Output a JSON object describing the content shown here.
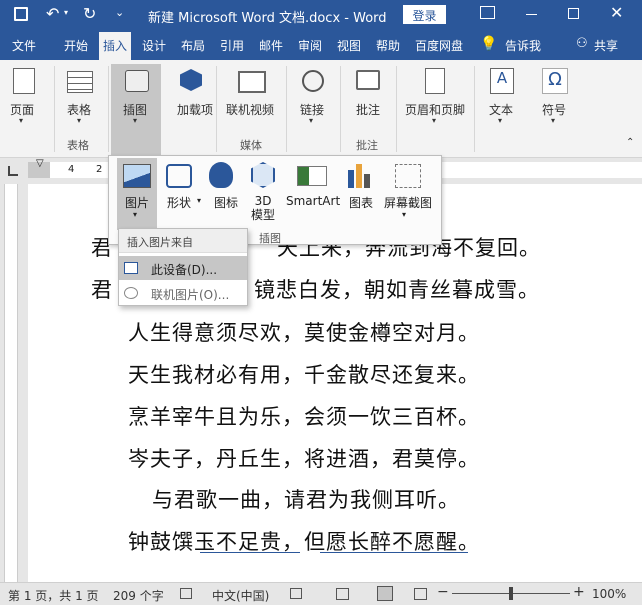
{
  "titlebar": {
    "title": "新建 Microsoft Word 文档.docx  -  Word",
    "login": "登录"
  },
  "tabs": [
    "文件",
    "开始",
    "插入",
    "设计",
    "布局",
    "引用",
    "邮件",
    "审阅",
    "视图",
    "帮助",
    "百度网盘",
    "告诉我",
    "共享"
  ],
  "ribbon": {
    "pages": "页面",
    "table": "表格",
    "illustrations": "插图",
    "addins": "加载项",
    "online_video": "联机视频",
    "link": "链接",
    "comment": "批注",
    "header_footer": "页眉和页脚",
    "text": "文本",
    "symbol": "符号",
    "group_table": "表格",
    "group_media": "媒体",
    "group_comment": "批注"
  },
  "ruler_ticks": [
    "4",
    "2"
  ],
  "gallery": {
    "picture": "图片",
    "shapes": "形状",
    "icons": "图标",
    "model3d": "3D\n模型",
    "smartart": "SmartArt",
    "chart": "图表",
    "screenshot": "屏幕截图",
    "group_label": "插图"
  },
  "menu": {
    "header": "插入图片来自",
    "this_device": "此设备(D)...",
    "online": "联机图片(O)..."
  },
  "document": {
    "lines": [
      "君不见，黄河之水天上来，奔流到海不复回。",
      "君不见，高堂明镜悲白发，朝如青丝暮成雪。",
      "人生得意须尽欢，莫使金樽空对月。",
      "天生我材必有用，千金散尽还复来。",
      "烹羊宰牛且为乐，会须一饮三百杯。",
      "岑夫子，丹丘生，将进酒，君莫停。",
      "与君歌一曲，请君为我侧耳听。",
      "钟鼓馔玉不足贵，但愿长醉不愿醒。"
    ],
    "line1_visible_start": "君",
    "line1_visible_end": "天上来，奔流到海不复回。",
    "line2_visible_start": "君",
    "line2_visible_end": "镜悲白发，朝如青丝暮成雪。"
  },
  "status": {
    "page": "第 1 页，共 1 页",
    "words": "209 个字",
    "language": "中文(中国)",
    "zoom": "100%"
  },
  "colors": {
    "brand": "#2b579a",
    "ribbon_bg": "#f3f3f3"
  }
}
